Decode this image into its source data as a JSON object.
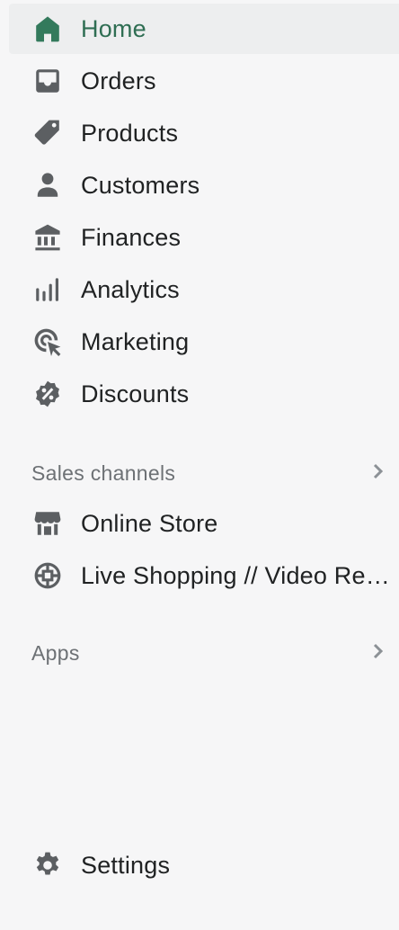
{
  "nav": {
    "items": [
      {
        "label": "Home",
        "icon": "home-icon"
      },
      {
        "label": "Orders",
        "icon": "inbox-icon"
      },
      {
        "label": "Products",
        "icon": "tag-icon"
      },
      {
        "label": "Customers",
        "icon": "person-icon"
      },
      {
        "label": "Finances",
        "icon": "bank-icon"
      },
      {
        "label": "Analytics",
        "icon": "bar-chart-icon"
      },
      {
        "label": "Marketing",
        "icon": "target-cursor-icon"
      },
      {
        "label": "Discounts",
        "icon": "discount-badge-icon"
      }
    ]
  },
  "sales_channels": {
    "title": "Sales channels",
    "items": [
      {
        "label": "Online Store",
        "icon": "store-icon"
      },
      {
        "label": "Live Shopping // Video Reels",
        "icon": "live-shopping-icon"
      }
    ]
  },
  "apps": {
    "title": "Apps"
  },
  "settings": {
    "label": "Settings",
    "icon": "gear-icon"
  },
  "colors": {
    "active": "#337a5c",
    "icon": "#5c5f62",
    "muted": "#6d7175"
  }
}
